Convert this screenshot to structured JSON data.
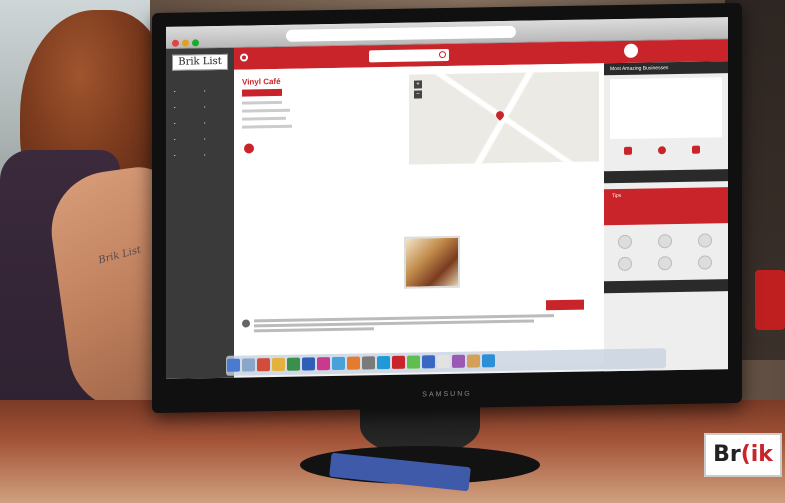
{
  "app": {
    "logo_text": "Brik List",
    "header_search_placeholder": "",
    "venue_title": "Vinyl Café",
    "venue_badge": "",
    "right_panel_heading": "Most Amazing Businesses",
    "right_alert_title": "Tips",
    "overlay_logo_left": "Br",
    "overlay_logo_right": "(ik",
    "monitor_brand": "SAMSUNG",
    "tattoo": "Brik List"
  },
  "colors": {
    "brand_red": "#c8242a",
    "sidebar_dark": "#3a3a3a"
  }
}
